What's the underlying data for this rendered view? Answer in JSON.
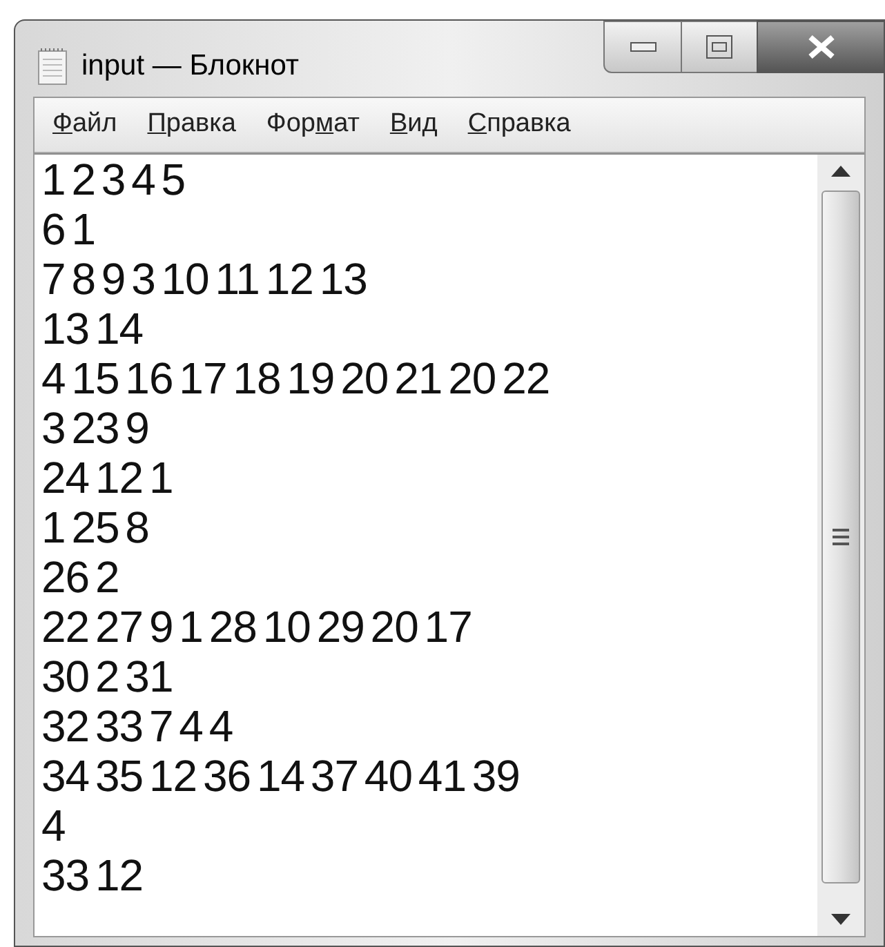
{
  "window": {
    "title": "input — Блокнот"
  },
  "menu": [
    {
      "key": "Ф",
      "post": "айл"
    },
    {
      "key": "П",
      "post": "равка"
    },
    {
      "pre": "Фор",
      "key": "м",
      "post": "ат"
    },
    {
      "key": "В",
      "post": "ид"
    },
    {
      "key": "С",
      "post": "правка"
    }
  ],
  "editor": {
    "lines": [
      "1 2 3 4 5",
      "6 1",
      "7 8 9 3 10 11 12 13",
      "13 14",
      "4 15 16 17 18 19 20 21 20 22",
      "3 23 9",
      "24 12 1",
      "1 25 8",
      "26 2",
      "22 27 9 1 28 10 29 20 17",
      "30 2 31",
      "32 33 7 4 4",
      "34 35 12 36 14 37 40 41 39",
      "4",
      "33 12"
    ]
  }
}
